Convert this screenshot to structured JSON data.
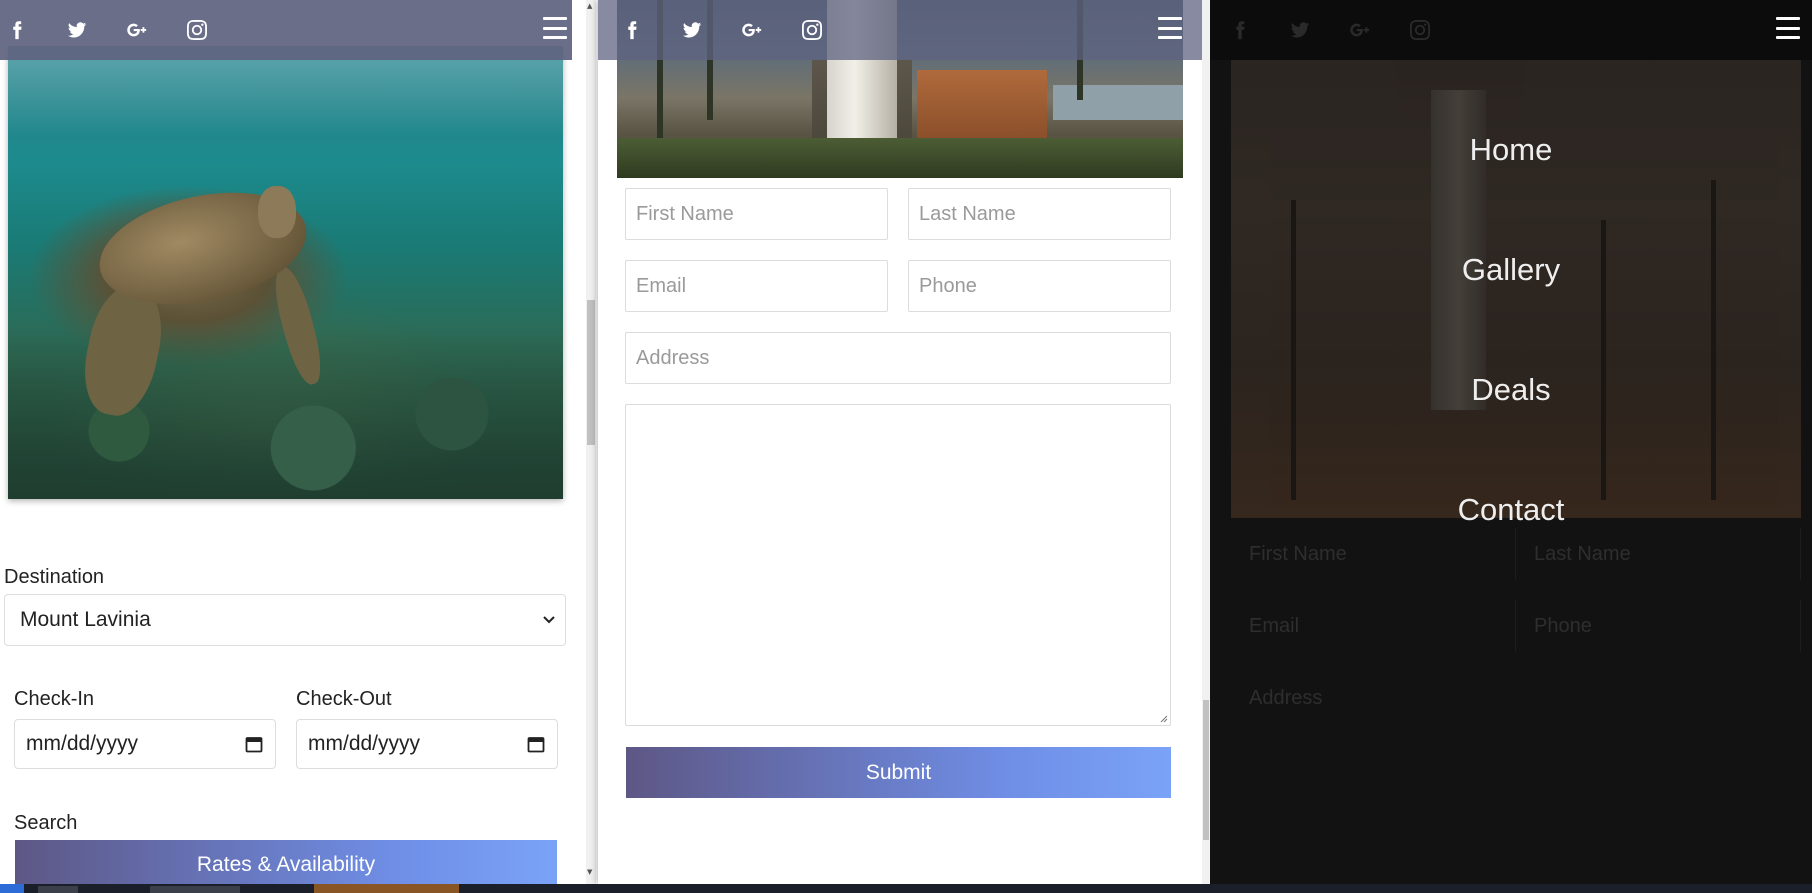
{
  "social_icons": [
    "facebook-icon",
    "twitter-icon",
    "google-plus-icon",
    "instagram-icon"
  ],
  "booking_panel": {
    "destination_label": "Destination",
    "destination_value": "Mount Lavinia",
    "checkin_label": "Check-In",
    "checkin_placeholder": "mm/dd/yyyy",
    "checkout_label": "Check-Out",
    "checkout_placeholder": "mm/dd/yyyy",
    "search_label": "Search",
    "rates_button": "Rates & Availability"
  },
  "contact_form": {
    "first_name_placeholder": "First Name",
    "last_name_placeholder": "Last Name",
    "email_placeholder": "Email",
    "phone_placeholder": "Phone",
    "address_placeholder": "Address",
    "submit_label": "Submit"
  },
  "nav_menu": {
    "items": [
      "Home",
      "Gallery",
      "Deals",
      "Contact"
    ]
  },
  "colors": {
    "gradient_start": "#5d5785",
    "gradient_end": "#7aa3f7",
    "topbar": "#5f6380",
    "overlay_dark": "#121212"
  }
}
